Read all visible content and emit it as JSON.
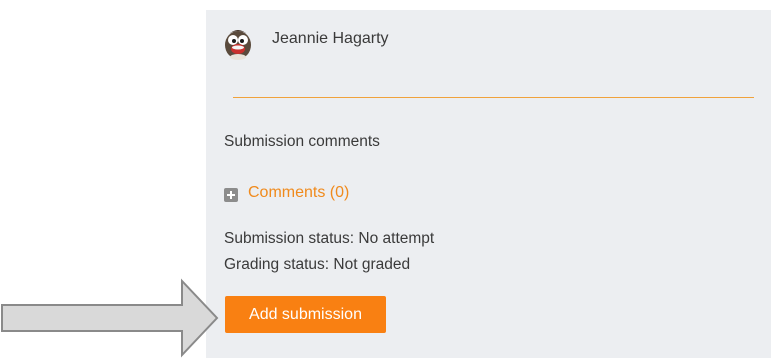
{
  "user": {
    "name": "Jeannie Hagarty",
    "avatar_icon": "cartoon-avatar-icon"
  },
  "submission": {
    "section_label": "Submission comments",
    "comments_link": "Comments (0)",
    "expand_icon": "plus-square-icon",
    "submission_status": "Submission status: No attempt",
    "grading_status": "Grading status: Not graded",
    "add_button_label": "Add submission"
  },
  "annotation": {
    "pointer_icon": "arrow-right-icon"
  },
  "colors": {
    "panel_bg": "#eceef1",
    "accent": "#f98012",
    "link": "#f08a1c",
    "divider": "#f0a23c",
    "text": "#3a3a3a"
  }
}
